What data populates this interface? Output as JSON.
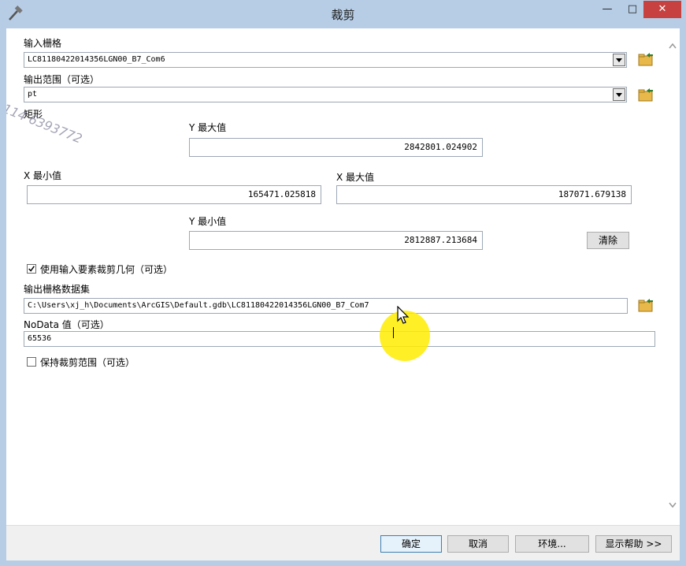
{
  "window": {
    "title": "裁剪",
    "minimize_glyph": "—",
    "maximize_glyph": "□",
    "close_glyph": "✕"
  },
  "input_raster": {
    "label": "输入栅格",
    "value": "LC81180422014356LGN00_B7_Com6"
  },
  "output_extent": {
    "label": "输出范围（可选）",
    "value": "pt"
  },
  "rectangle": {
    "label": "矩形",
    "y_max_label": "Y 最大值",
    "y_max_value": "2842801.024902",
    "x_min_label": "X 最小值",
    "x_min_value": "165471.025818",
    "x_max_label": "X 最大值",
    "x_max_value": "187071.679138",
    "y_min_label": "Y 最小值",
    "y_min_value": "2812887.213684",
    "clear_label": "清除"
  },
  "use_input_features": {
    "label": "使用输入要素裁剪几何（可选）",
    "checked": true
  },
  "output_raster": {
    "label": "输出栅格数据集",
    "value": "C:\\Users\\xj_h\\Documents\\ArcGIS\\Default.gdb\\LC81180422014356LGN00_B7_Com7"
  },
  "nodata": {
    "label": "NoData 值（可选）",
    "value": "65536"
  },
  "maintain_extent": {
    "label": "保持裁剪范围（可选）",
    "checked": false
  },
  "footer": {
    "ok_label": "确定",
    "cancel_label": "取消",
    "env_label": "环境...",
    "help_label": "显示帮助 >>"
  },
  "watermark": {
    "text": "114 6393772"
  },
  "colors": {
    "title_bar": "#b6cde5",
    "close_button": "#c6413f",
    "cursor_highlight": "#ffec00"
  }
}
